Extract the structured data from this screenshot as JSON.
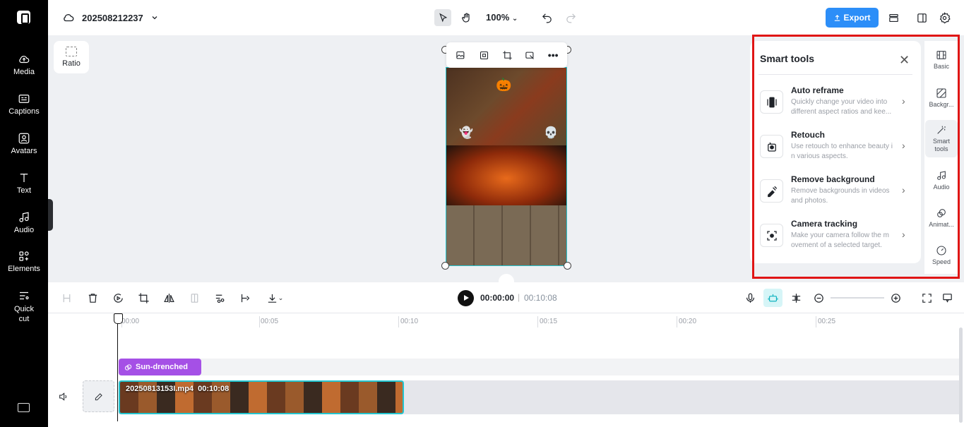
{
  "sidebar": {
    "items": [
      {
        "label": "Media",
        "icon": "cloud-upload-icon"
      },
      {
        "label": "Captions",
        "icon": "captions-icon"
      },
      {
        "label": "Avatars",
        "icon": "avatar-icon"
      },
      {
        "label": "Text",
        "icon": "text-icon"
      },
      {
        "label": "Audio",
        "icon": "music-note-icon"
      },
      {
        "label": "Elements",
        "icon": "elements-icon"
      },
      {
        "label": "Quick cut",
        "icon": "quick-cut-icon"
      }
    ]
  },
  "topbar": {
    "project_name": "202508212237",
    "zoom": "100%",
    "export_label": "Export"
  },
  "canvas": {
    "ratio_label": "Ratio"
  },
  "smart_tools": {
    "title": "Smart tools",
    "items": [
      {
        "name": "Auto reframe",
        "desc": "Quickly change your video into different aspect ratios and kee..."
      },
      {
        "name": "Retouch",
        "desc": "Use retouch to enhance beauty i n various aspects."
      },
      {
        "name": "Remove background",
        "desc": "Remove backgrounds in videos and photos."
      },
      {
        "name": "Camera tracking",
        "desc": "Make your camera follow the m ovement of a selected target."
      }
    ]
  },
  "right_rail": {
    "items": [
      {
        "label": "Basic"
      },
      {
        "label": "Backgr..."
      },
      {
        "label": "Smart tools"
      },
      {
        "label": "Audio"
      },
      {
        "label": "Animat..."
      },
      {
        "label": "Speed"
      }
    ]
  },
  "timeline": {
    "current_time": "00:00:00",
    "separator": "|",
    "total_time": "00:10:08",
    "ruler": [
      "00:00",
      "00:05",
      "00:10",
      "00:15",
      "00:20",
      "00:25"
    ],
    "effect_label": "Sun-drenched",
    "clip_name": "20250813153I.mp4",
    "clip_duration": "00:10:08"
  },
  "colors": {
    "accent": "#2c8ef8",
    "selection": "#23c5d0",
    "effect": "#a550e6",
    "highlight": "#e01515"
  }
}
